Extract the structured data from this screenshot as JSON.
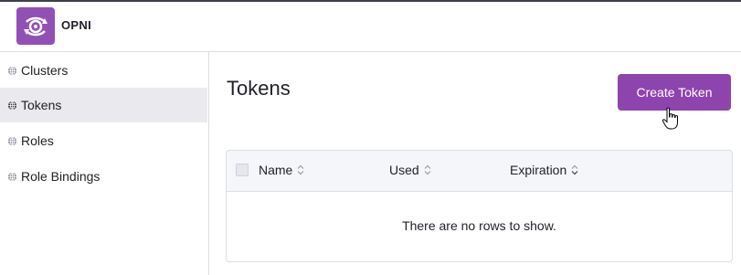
{
  "header": {
    "brand": "OPNI",
    "logo_icon": "eye-sync-logo-icon"
  },
  "sidebar": {
    "items": [
      {
        "label": "Clusters",
        "icon": "globe-icon",
        "active": false
      },
      {
        "label": "Tokens",
        "icon": "globe-icon",
        "active": true
      },
      {
        "label": "Roles",
        "icon": "globe-icon",
        "active": false
      },
      {
        "label": "Role Bindings",
        "icon": "globe-icon",
        "active": false
      }
    ]
  },
  "main": {
    "title": "Tokens",
    "create_button": "Create Token",
    "table": {
      "columns": [
        "Name",
        "Used",
        "Expiration"
      ],
      "empty_message": "There are no rows to show."
    }
  },
  "colors": {
    "accent": "#8e44ad",
    "logo_bg": "#9150b5",
    "active_nav": "#e9e9ee"
  }
}
